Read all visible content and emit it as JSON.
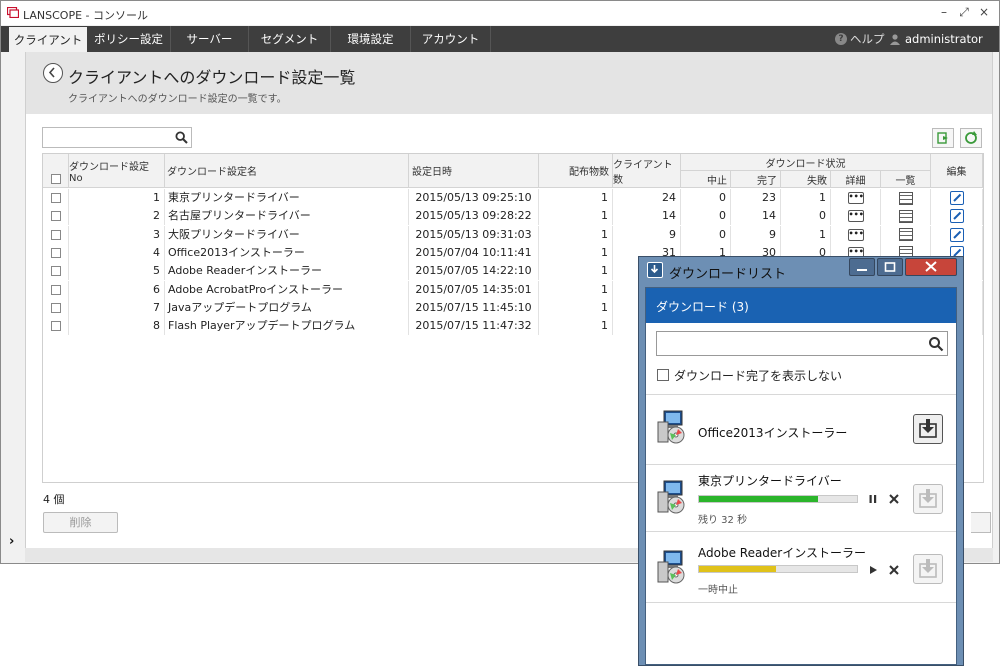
{
  "app": {
    "title": "LANSCOPE - コンソール",
    "controls": {
      "minimize": "–",
      "maximize": "⤢",
      "close": "×"
    }
  },
  "menu": {
    "tabs": [
      {
        "label": "クライアント",
        "active": true
      },
      {
        "label": "ポリシー設定",
        "active": false
      },
      {
        "label": "サーバー",
        "active": false
      },
      {
        "label": "セグメント",
        "active": false
      },
      {
        "label": "環境設定",
        "active": false
      },
      {
        "label": "アカウント",
        "active": false
      }
    ],
    "help": "ヘルプ",
    "user": "administrator"
  },
  "page": {
    "title": "クライアントへのダウンロード設定一覧",
    "subtitle": "クライアントへのダウンロード設定の一覧です。"
  },
  "table": {
    "headers": {
      "no": "ダウンロード設定No",
      "name": "ダウンロード設定名",
      "datetime": "設定日時",
      "distributed": "配布物数",
      "clients": "クライアント数",
      "status_group": "ダウンロード状況",
      "aborted": "中止",
      "completed": "完了",
      "failed": "失敗",
      "detail": "詳細",
      "list": "一覧",
      "edit": "編集"
    },
    "rows": [
      {
        "no": "1",
        "name": "東京プリンタードライバー",
        "datetime": "2015/05/13 09:25:10",
        "distributed": "1",
        "clients": "24",
        "aborted": "0",
        "completed": "23",
        "failed": "1"
      },
      {
        "no": "2",
        "name": "名古屋プリンタードライバー",
        "datetime": "2015/05/13 09:28:22",
        "distributed": "1",
        "clients": "14",
        "aborted": "0",
        "completed": "14",
        "failed": "0"
      },
      {
        "no": "3",
        "name": "大阪プリンタードライバー",
        "datetime": "2015/05/13 09:31:03",
        "distributed": "1",
        "clients": "9",
        "aborted": "0",
        "completed": "9",
        "failed": "1"
      },
      {
        "no": "4",
        "name": "Office2013インストーラー",
        "datetime": "2015/07/04 10:11:41",
        "distributed": "1",
        "clients": "31",
        "aborted": "1",
        "completed": "30",
        "failed": "0"
      },
      {
        "no": "5",
        "name": "Adobe Readerインストーラー",
        "datetime": "2015/07/05 14:22:10",
        "distributed": "1",
        "clients": "",
        "aborted": "",
        "completed": "",
        "failed": ""
      },
      {
        "no": "6",
        "name": "Adobe AcrobatProインストーラー",
        "datetime": "2015/07/05 14:35:01",
        "distributed": "1",
        "clients": "",
        "aborted": "",
        "completed": "",
        "failed": ""
      },
      {
        "no": "7",
        "name": "Javaアップデートプログラム",
        "datetime": "2015/07/15 11:45:10",
        "distributed": "1",
        "clients": "",
        "aborted": "",
        "completed": "",
        "failed": ""
      },
      {
        "no": "8",
        "name": "Flash Playerアップデートプログラム",
        "datetime": "2015/07/15 11:47:32",
        "distributed": "1",
        "clients": "",
        "aborted": "",
        "completed": "",
        "failed": ""
      }
    ],
    "count_label": "4 個"
  },
  "buttons": {
    "delete": "削除"
  },
  "sidebar": {
    "expand": "›"
  },
  "download_dialog": {
    "title": "ダウンロードリスト",
    "header": "ダウンロード (3)",
    "search_placeholder": "",
    "hide_completed_label": "ダウンロード完了を表示しない",
    "items": [
      {
        "name": "Office2013インストーラー",
        "status": "",
        "progress": null
      },
      {
        "name": "東京プリンタードライバー",
        "status": "残り 32 秒",
        "progress": 0.75,
        "color": "#2bb52b"
      },
      {
        "name": "Adobe Readerインストーラー",
        "status": "一時中止",
        "progress": 0.49,
        "color": "#e0c21a"
      }
    ]
  }
}
